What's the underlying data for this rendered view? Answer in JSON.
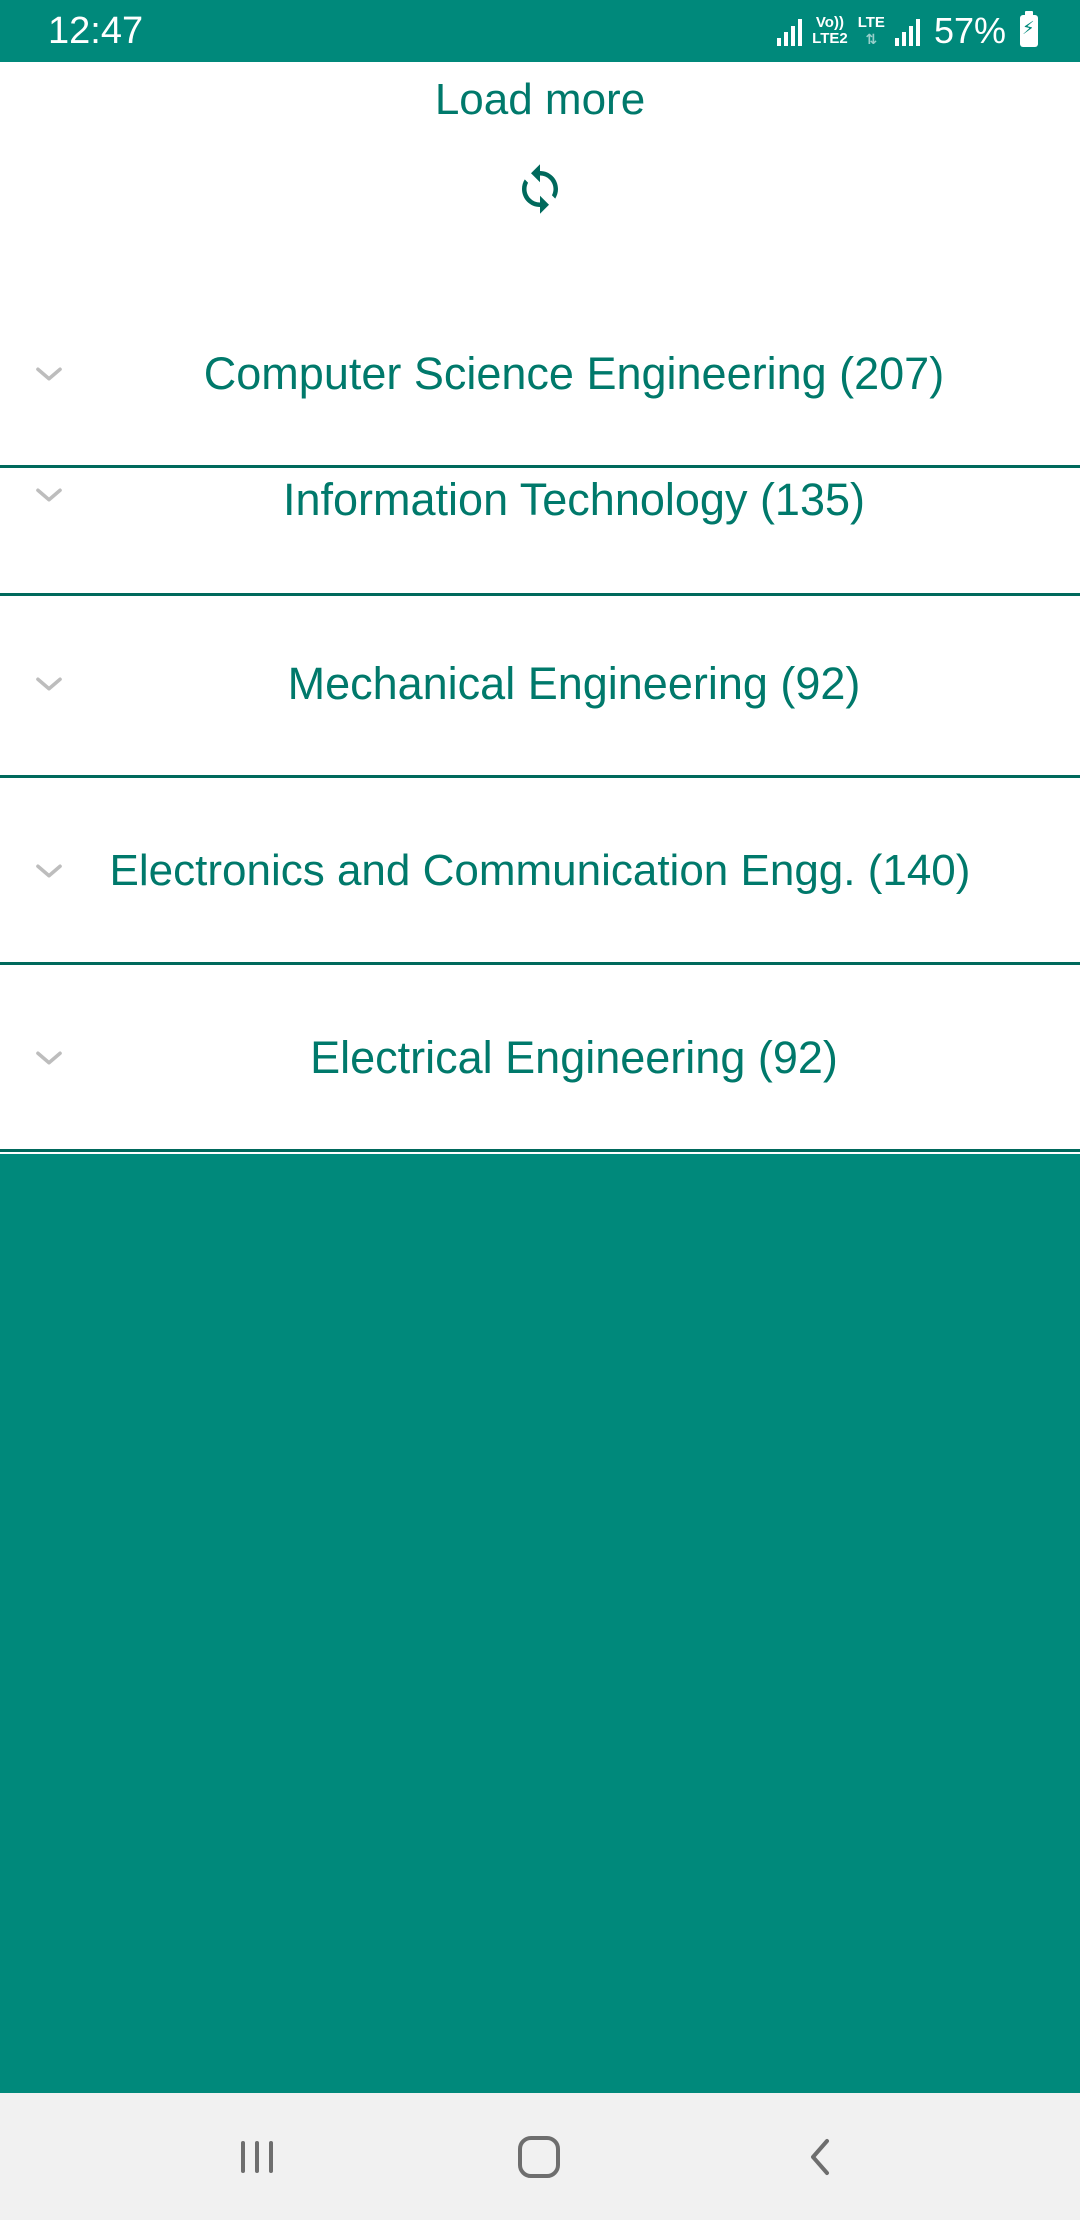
{
  "status_bar": {
    "time": "12:47",
    "net_top": "Vo))",
    "net_bottom": "LTE2",
    "lte_label": "LTE",
    "battery": "57%"
  },
  "load_more": {
    "label": "Load more",
    "icon": "refresh-icon"
  },
  "categories": [
    {
      "label": "Computer Science Engineering (207)",
      "icon": "chevron-down-icon"
    },
    {
      "label": "Information Technology (135)",
      "icon": "chevron-down-icon"
    },
    {
      "label": "Mechanical Engineering (92)",
      "icon": "chevron-down-icon"
    },
    {
      "label": "Electronics and Communication Engg. (140)",
      "icon": "chevron-down-icon"
    },
    {
      "label": "Electrical Engineering (92)",
      "icon": "chevron-down-icon"
    }
  ],
  "nav_bar": {
    "recents": "recents-icon",
    "home": "home-icon",
    "back": "back-icon"
  },
  "colors": {
    "primary": "#00897b",
    "text": "#00796b",
    "divider": "#00695c",
    "chevron": "#bdbdbd"
  }
}
